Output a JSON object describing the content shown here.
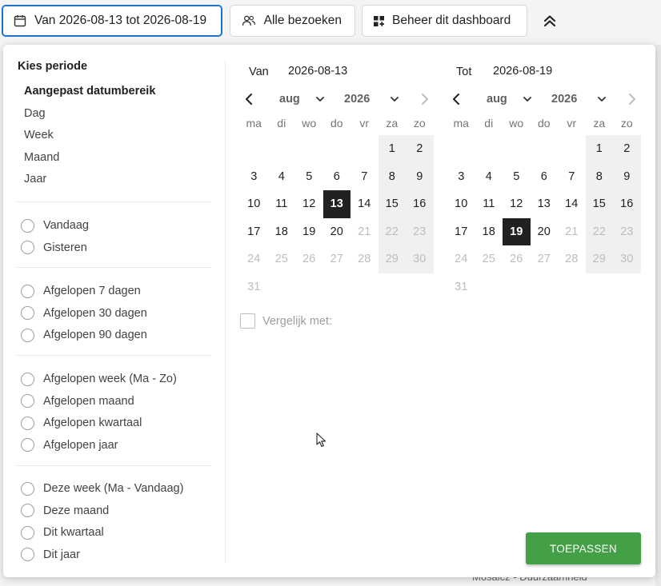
{
  "toolbar": {
    "date_range_label": "Van 2026-08-13 tot 2026-08-19",
    "segment_label": "Alle bezoeken",
    "dashboard_label": "Beheer dit dashboard"
  },
  "background": {
    "footer_text": "Mosaicz - Duurzaamheid"
  },
  "period": {
    "title": "Kies periode",
    "types": [
      "Aangepast datumbereik",
      "Dag",
      "Week",
      "Maand",
      "Jaar"
    ],
    "selected_type": "Aangepast datumbereik",
    "groups": [
      [
        "Vandaag",
        "Gisteren"
      ],
      [
        "Afgelopen 7 dagen",
        "Afgelopen 30 dagen",
        "Afgelopen 90 dagen"
      ],
      [
        "Afgelopen week (Ma - Zo)",
        "Afgelopen maand",
        "Afgelopen kwartaal",
        "Afgelopen jaar"
      ],
      [
        "Deze week (Ma - Vandaag)",
        "Deze maand",
        "Dit kwartaal",
        "Dit jaar"
      ]
    ]
  },
  "range": {
    "from_label": "Van",
    "from_value": "2026-08-13",
    "to_label": "Tot",
    "to_value": "2026-08-19"
  },
  "calendars": [
    {
      "month": "aug",
      "year": "2026",
      "selected_day": "13",
      "weekdays": [
        "ma",
        "di",
        "wo",
        "do",
        "vr",
        "za",
        "zo"
      ],
      "weeks": [
        [
          "",
          "",
          "",
          "",
          "",
          "1",
          "2"
        ],
        [
          "3",
          "4",
          "5",
          "6",
          "7",
          "8",
          "9"
        ],
        [
          "10",
          "11",
          "12",
          "13",
          "14",
          "15",
          "16"
        ],
        [
          "17",
          "18",
          "19",
          "20",
          "21",
          "22",
          "23"
        ],
        [
          "24",
          "25",
          "26",
          "27",
          "28",
          "29",
          "30"
        ],
        [
          "31",
          "",
          "",
          "",
          "",
          "",
          ""
        ]
      ]
    },
    {
      "month": "aug",
      "year": "2026",
      "selected_day": "19",
      "weekdays": [
        "ma",
        "di",
        "wo",
        "do",
        "vr",
        "za",
        "zo"
      ],
      "weeks": [
        [
          "",
          "",
          "",
          "",
          "",
          "1",
          "2"
        ],
        [
          "3",
          "4",
          "5",
          "6",
          "7",
          "8",
          "9"
        ],
        [
          "10",
          "11",
          "12",
          "13",
          "14",
          "15",
          "16"
        ],
        [
          "17",
          "18",
          "19",
          "20",
          "21",
          "22",
          "23"
        ],
        [
          "24",
          "25",
          "26",
          "27",
          "28",
          "29",
          "30"
        ],
        [
          "31",
          "",
          "",
          "",
          "",
          "",
          ""
        ]
      ]
    }
  ],
  "compare": {
    "label": "Vergelijk met:"
  },
  "apply_label": "TOEPASSEN",
  "colors": {
    "selected_day": "#212121",
    "apply_button": "#43a047",
    "active_border": "#1a73c8"
  }
}
